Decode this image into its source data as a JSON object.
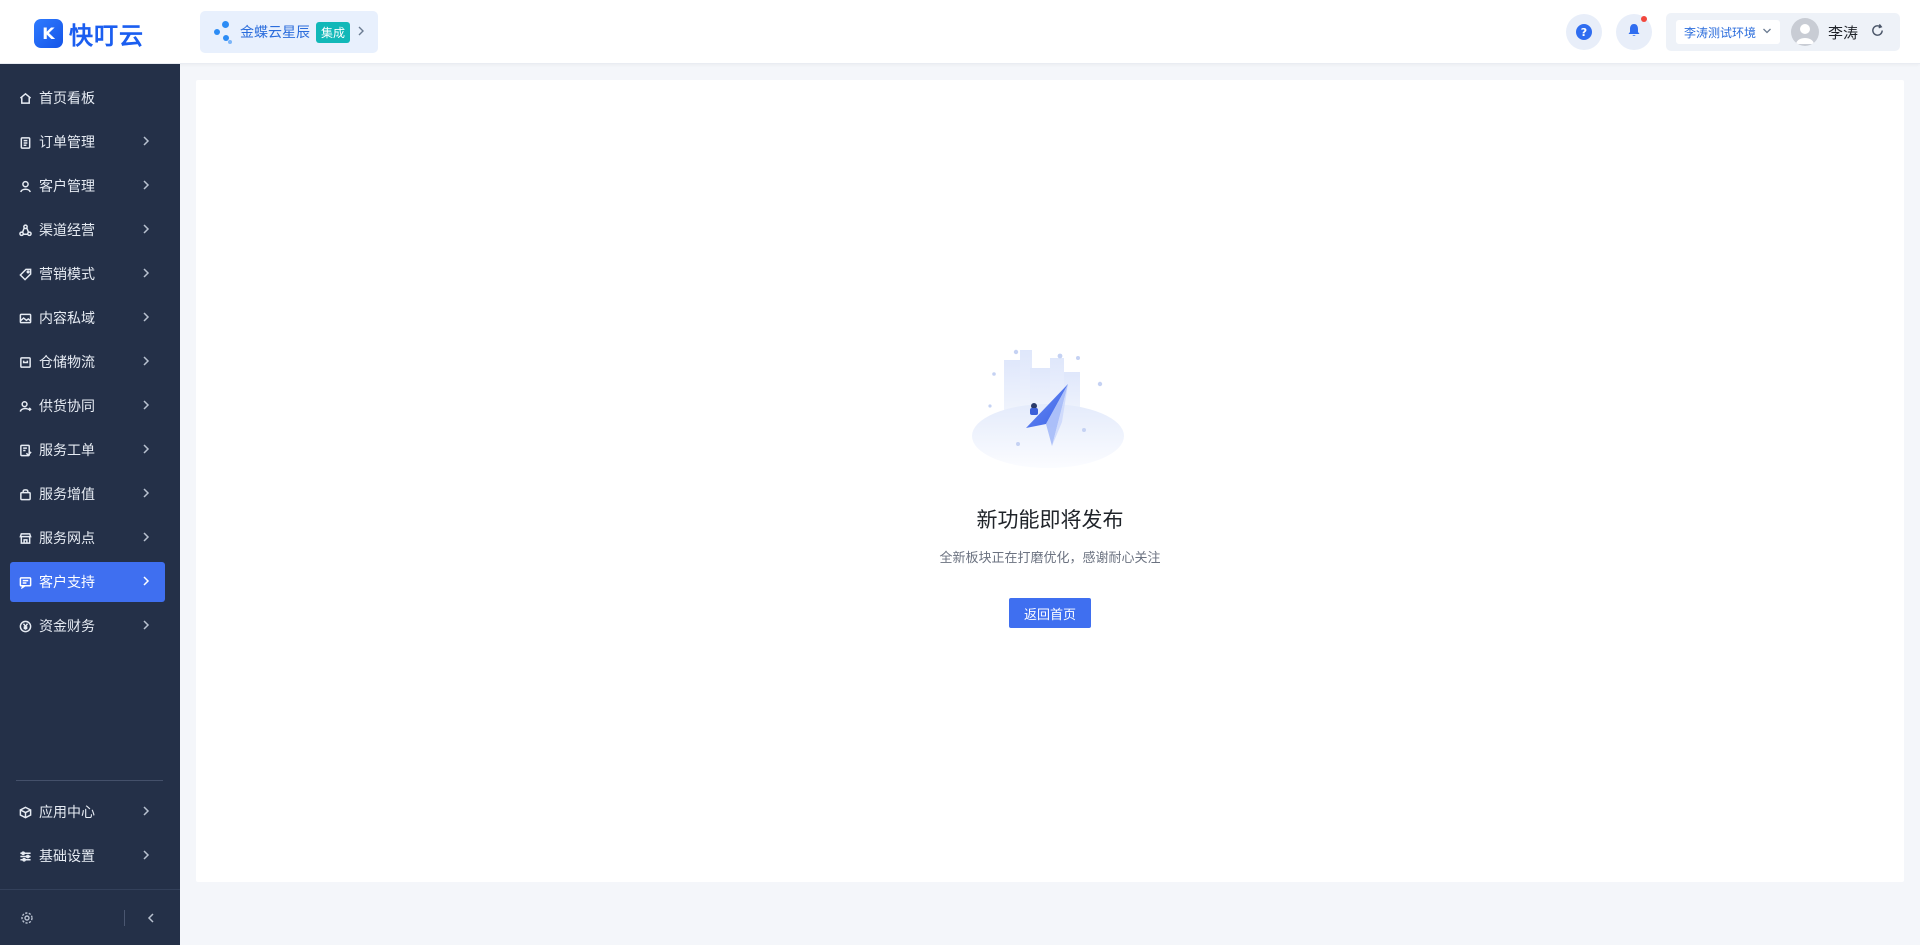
{
  "header": {
    "logo_mark": "K",
    "logo_text": "快叮云",
    "integration_label": "金蝶云星辰",
    "integration_badge": "集成",
    "help_label": "?",
    "environment": "李涛测试环境",
    "user_name": "李涛"
  },
  "sidebar": {
    "items": [
      {
        "label": "首页看板",
        "icon": "home-icon",
        "has_children": false
      },
      {
        "label": "订单管理",
        "icon": "clipboard-icon",
        "has_children": true
      },
      {
        "label": "客户管理",
        "icon": "user-icon",
        "has_children": true
      },
      {
        "label": "渠道经营",
        "icon": "share-icon",
        "has_children": true
      },
      {
        "label": "营销模式",
        "icon": "tag-icon",
        "has_children": true
      },
      {
        "label": "内容私域",
        "icon": "image-icon",
        "has_children": true
      },
      {
        "label": "仓储物流",
        "icon": "box-icon",
        "has_children": true
      },
      {
        "label": "供货协同",
        "icon": "supplier-icon",
        "has_children": true
      },
      {
        "label": "服务工单",
        "icon": "work-order-icon",
        "has_children": true
      },
      {
        "label": "服务增值",
        "icon": "bag-icon",
        "has_children": true
      },
      {
        "label": "服务网点",
        "icon": "store-icon",
        "has_children": true
      },
      {
        "label": "客户支持",
        "icon": "support-icon",
        "has_children": true,
        "active": true
      },
      {
        "label": "资金财务",
        "icon": "yuan-icon",
        "has_children": true
      }
    ],
    "bottom_items": [
      {
        "label": "应用中心",
        "icon": "cube-icon"
      },
      {
        "label": "基础设置",
        "icon": "settings-icon"
      }
    ]
  },
  "main": {
    "title": "新功能即将发布",
    "subtitle": "全新板块正在打磨优化，感谢耐心关注",
    "home_button": "返回首页"
  },
  "colors": {
    "accent": "#3f6ff0",
    "sidebar_bg": "#243048",
    "brand": "#1b5ef0",
    "badge": "#12b8b8"
  }
}
